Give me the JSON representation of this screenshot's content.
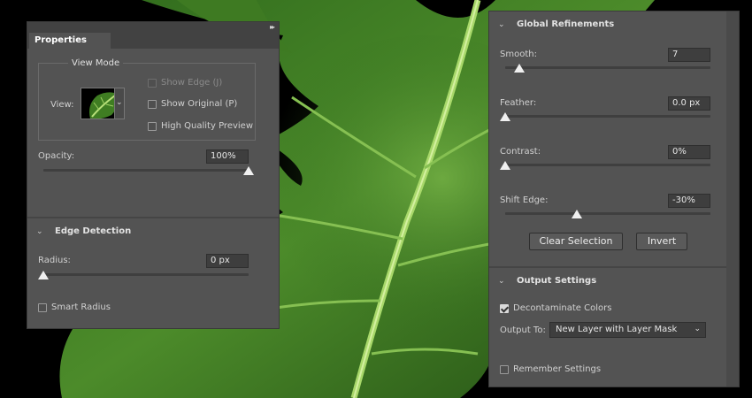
{
  "properties_panel": {
    "tab": "Properties",
    "collapse_icon": "double-chevron-right-icon",
    "view_mode": {
      "legend": "View Mode",
      "view_label": "View:",
      "show_edge": "Show Edge (J)",
      "show_original": "Show Original (P)",
      "high_quality_preview": "High Quality Preview"
    },
    "opacity": {
      "label": "Opacity:",
      "value": "100%",
      "level": 1.0
    },
    "edge_detection": {
      "title": "Edge Detection",
      "radius_label": "Radius:",
      "radius_value": "0 px",
      "radius_level": 0.0,
      "smart_radius": "Smart Radius"
    }
  },
  "refine_panel": {
    "global_refinements": {
      "title": "Global Refinements",
      "smooth": {
        "label": "Smooth:",
        "value": "7",
        "level": 0.07
      },
      "feather": {
        "label": "Feather:",
        "value": "0.0 px",
        "level": 0.0
      },
      "contrast": {
        "label": "Contrast:",
        "value": "0%",
        "level": 0.0
      },
      "shift_edge": {
        "label": "Shift Edge:",
        "value": "-30%",
        "level": 0.35
      }
    },
    "buttons": {
      "clear_selection": "Clear Selection",
      "invert": "Invert"
    },
    "output_settings": {
      "title": "Output Settings",
      "decontaminate": "Decontaminate Colors",
      "decontaminate_checked": true,
      "output_to_label": "Output To:",
      "output_to_value": "New Layer with Layer Mask"
    },
    "remember_settings": "Remember Settings"
  },
  "colors": {
    "panel_bg": "#535353",
    "leaf_dark": "#1e4f12",
    "leaf_light": "#5a9a2e",
    "vein": "#a8d86a"
  }
}
